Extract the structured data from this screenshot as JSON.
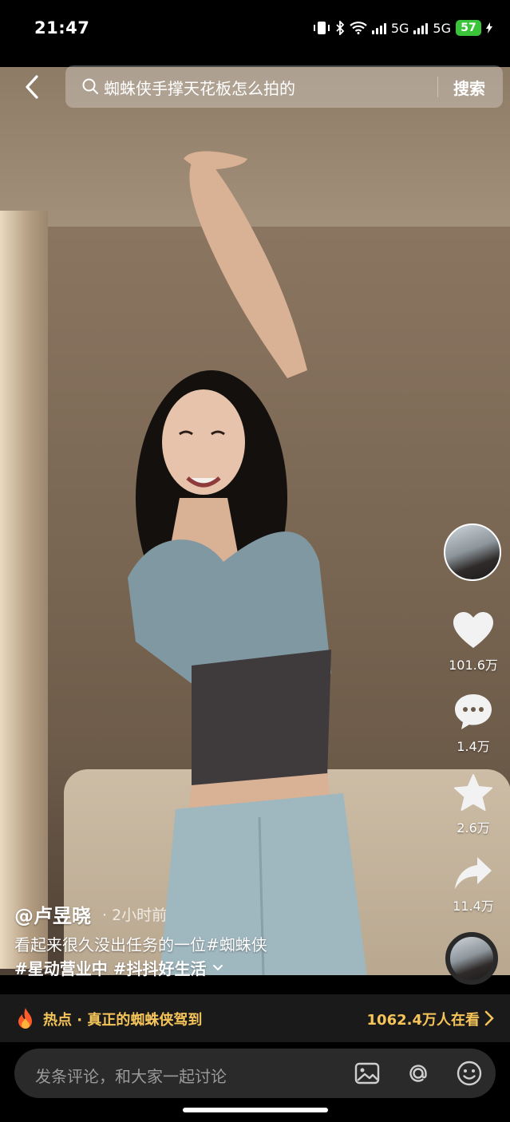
{
  "status_bar": {
    "time": "21:47",
    "network_1": "5G",
    "network_2": "5G",
    "battery": "57"
  },
  "search": {
    "query": "蜘蛛侠手撑天花板怎么拍的",
    "button_label": "搜索"
  },
  "rail": {
    "likes": "101.6万",
    "comments": "1.4万",
    "favorites": "2.6万",
    "shares": "11.4万"
  },
  "post": {
    "author": "@卢昱晓",
    "time": "· 2小时前",
    "caption_line1": "看起来很久没出任务的一位#蜘蛛侠",
    "caption_tags": "#星动营业中 #抖抖好生活"
  },
  "hot": {
    "label": "热点 · 真正的蜘蛛侠驾到",
    "viewers": "1062.4万人在看"
  },
  "comment": {
    "placeholder": "发条评论，和大家一起讨论"
  },
  "colors": {
    "hot_accent": "#f5c45a",
    "battery": "#3ac43a"
  },
  "icons": [
    "back-arrow-icon",
    "search-icon",
    "heart-icon",
    "comment-icon",
    "star-icon",
    "share-icon",
    "flame-icon",
    "chevron-right-icon",
    "image-icon",
    "at-icon",
    "emoji-icon"
  ]
}
